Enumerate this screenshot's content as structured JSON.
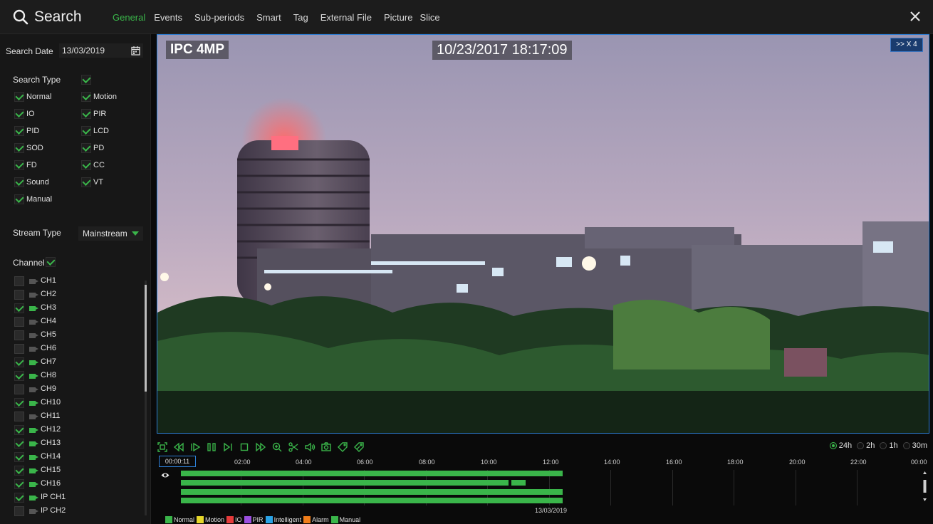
{
  "header": {
    "title": "Search",
    "tabs": [
      "General",
      "Events",
      "Sub-periods",
      "Smart",
      "Tag",
      "External File",
      "Picture",
      "Slice"
    ],
    "active_tab": "General"
  },
  "search_date": {
    "label": "Search Date",
    "value": "13/03/2019"
  },
  "search_type": {
    "label": "Search Type",
    "all_checked": true,
    "items": [
      {
        "label": "Normal",
        "checked": true
      },
      {
        "label": "Motion",
        "checked": true
      },
      {
        "label": "IO",
        "checked": true
      },
      {
        "label": "PIR",
        "checked": true
      },
      {
        "label": "PID",
        "checked": true
      },
      {
        "label": "LCD",
        "checked": true
      },
      {
        "label": "SOD",
        "checked": true
      },
      {
        "label": "PD",
        "checked": true
      },
      {
        "label": "FD",
        "checked": true
      },
      {
        "label": "CC",
        "checked": true
      },
      {
        "label": "Sound",
        "checked": true
      },
      {
        "label": "VT",
        "checked": true
      },
      {
        "label": "Manual",
        "checked": true
      }
    ]
  },
  "stream_type": {
    "label": "Stream Type",
    "value": "Mainstream"
  },
  "channel": {
    "label": "Channel",
    "all_checked": true,
    "items": [
      {
        "name": "CH1",
        "checked": false
      },
      {
        "name": "CH2",
        "checked": false
      },
      {
        "name": "CH3",
        "checked": true
      },
      {
        "name": "CH4",
        "checked": false
      },
      {
        "name": "CH5",
        "checked": false
      },
      {
        "name": "CH6",
        "checked": false
      },
      {
        "name": "CH7",
        "checked": true
      },
      {
        "name": "CH8",
        "checked": true
      },
      {
        "name": "CH9",
        "checked": false
      },
      {
        "name": "CH10",
        "checked": true
      },
      {
        "name": "CH11",
        "checked": false
      },
      {
        "name": "CH12",
        "checked": true
      },
      {
        "name": "CH13",
        "checked": true
      },
      {
        "name": "CH14",
        "checked": true
      },
      {
        "name": "CH15",
        "checked": true
      },
      {
        "name": "CH16",
        "checked": true
      },
      {
        "name": "IP CH1",
        "checked": true
      },
      {
        "name": "IP CH2",
        "checked": false
      }
    ]
  },
  "video": {
    "camera_label": "IPC 4MP",
    "timestamp": "10/23/2017 18:17:09",
    "speed_label": ">> X 4"
  },
  "controls": [
    "fullscreen-icon",
    "rewind-icon",
    "slow-play-icon",
    "pause-icon",
    "step-forward-icon",
    "stop-icon",
    "fast-forward-icon",
    "zoom-icon",
    "clip-icon",
    "audio-icon",
    "snapshot-icon",
    "tag-icon",
    "tag-edit-icon"
  ],
  "zoom_options": [
    {
      "label": "24h",
      "selected": true
    },
    {
      "label": "2h",
      "selected": false
    },
    {
      "label": "1h",
      "selected": false
    },
    {
      "label": "30m",
      "selected": false
    }
  ],
  "timeline": {
    "cursor_time": "00:00:11",
    "ticks": [
      "02:00",
      "04:00",
      "06:00",
      "08:00",
      "10:00",
      "12:00",
      "14:00",
      "16:00",
      "18:00",
      "20:00",
      "22:00",
      "00:00"
    ],
    "date": "13/03/2019"
  },
  "legend": [
    {
      "label": "Normal",
      "color": "#3ab54a"
    },
    {
      "label": "Motion",
      "color": "#e6d72a"
    },
    {
      "label": "IO",
      "color": "#e63b3b"
    },
    {
      "label": "PIR",
      "color": "#9b4fe0"
    },
    {
      "label": "Intelligent",
      "color": "#2aa3e6"
    },
    {
      "label": "Alarm",
      "color": "#f07d1a"
    },
    {
      "label": "Manual",
      "color": "#3ab54a"
    }
  ],
  "colors": {
    "accent": "#3ab54a",
    "selection": "#2d7fd6"
  }
}
